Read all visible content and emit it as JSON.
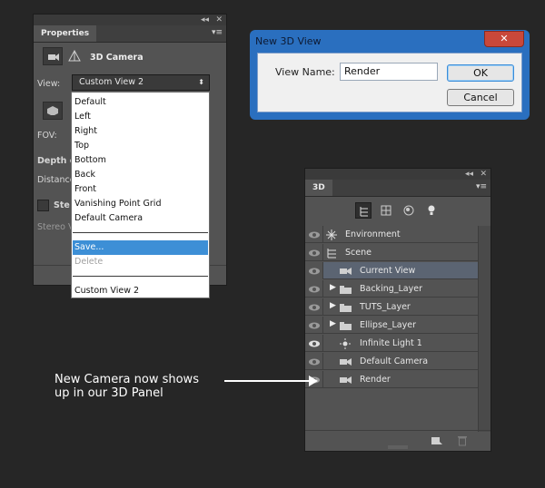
{
  "properties_panel": {
    "collapse_glyph": "◂◂",
    "close_glyph": "✕",
    "tab": "Properties",
    "menu_glyph": "▾≡",
    "section_title": "3D Camera",
    "view_label": "View:",
    "view_value": "Custom View 2",
    "fov_label": "FOV:",
    "depth_label": "Depth o",
    "distance_label": "Distance",
    "stereo_label": "Ste",
    "stereo_sub": "Stereo V"
  },
  "view_dropdown": {
    "items": [
      {
        "label": "Default"
      },
      {
        "label": "Left"
      },
      {
        "label": "Right"
      },
      {
        "label": "Top"
      },
      {
        "label": "Bottom"
      },
      {
        "label": "Back"
      },
      {
        "label": "Front"
      },
      {
        "label": "Vanishing Point Grid"
      },
      {
        "label": "Default Camera"
      }
    ],
    "save": "Save...",
    "delete": "Delete",
    "custom": "Custom View 2"
  },
  "dialog": {
    "title": "New 3D View",
    "close_glyph": "✕",
    "field_label": "View Name:",
    "field_value": "Render",
    "ok": "OK",
    "cancel": "Cancel"
  },
  "panel_3d": {
    "collapse_glyph": "◂◂",
    "close_glyph": "✕",
    "tab": "3D",
    "menu_glyph": "▾≡",
    "toolbar_icons": [
      "scene-filter-icon",
      "mesh-filter-icon",
      "material-filter-icon",
      "light-filter-icon"
    ],
    "layers": [
      {
        "label": "Environment",
        "icon": "environment-icon",
        "visible": true
      },
      {
        "label": "Scene",
        "icon": "scene-icon",
        "visible": true
      },
      {
        "label": "Current View",
        "icon": "camera-icon",
        "visible": true,
        "selected": true
      },
      {
        "label": "Backing_Layer",
        "icon": "folder-icon",
        "visible": true
      },
      {
        "label": "TUTS_Layer",
        "icon": "folder-icon",
        "visible": true
      },
      {
        "label": "Ellipse_Layer",
        "icon": "folder-icon",
        "visible": true
      },
      {
        "label": "Infinite Light 1",
        "icon": "light-icon",
        "visible": true
      },
      {
        "label": "Default Camera",
        "icon": "camera-icon",
        "visible": true
      },
      {
        "label": "Render",
        "icon": "camera-icon",
        "visible": true
      }
    ]
  },
  "annotation": {
    "line1": "New Camera now shows",
    "line2": "up in our 3D Panel"
  },
  "colors": {
    "background": "#262626",
    "panel": "#535353",
    "dropdown_highlight": "#3d8fd6",
    "dialog_frame": "#2a6fbf"
  }
}
